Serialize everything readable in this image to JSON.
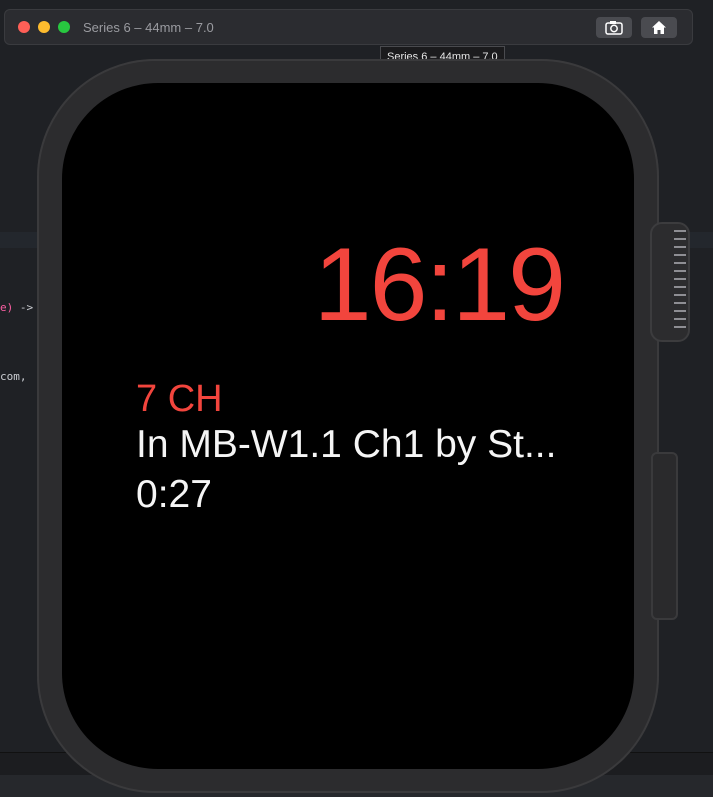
{
  "window": {
    "title": "Series 6 – 44mm – 7.0",
    "tooltip": "Series 6 – 44mm – 7.0",
    "buttons": {
      "screenshot_icon": "camera-icon",
      "home_icon": "home-icon"
    }
  },
  "watch": {
    "time": "16:19",
    "now_playing": {
      "channel": "7 CH",
      "track": "In MB-W1.1 Ch1 by St...",
      "elapsed": "0:27"
    }
  },
  "editor_fragments": {
    "line1_kw": "e)",
    "line1_rest": " ->",
    "line2": "com,"
  },
  "colors": {
    "accent": "#f2453d",
    "screen": "#000000",
    "case": "#2c2c2e"
  }
}
